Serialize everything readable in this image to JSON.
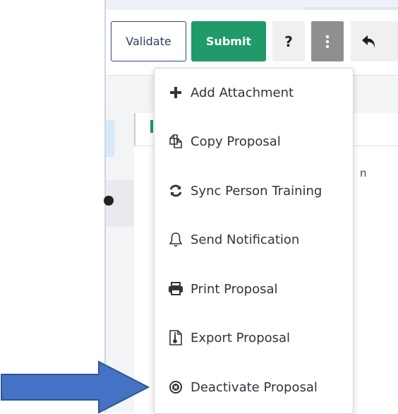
{
  "toolbar": {
    "validate_label": "Validate",
    "submit_label": "Submit",
    "help_label": "?",
    "more_icon": "vertical-ellipsis-icon",
    "undo_icon": "undo-arrow-icon"
  },
  "content": {
    "stray_text": "n"
  },
  "menu": {
    "items": [
      {
        "label": "Add Attachment",
        "icon": "plus-icon"
      },
      {
        "label": "Copy Proposal",
        "icon": "copy-icon"
      },
      {
        "label": "Sync Person Training",
        "icon": "sync-icon"
      },
      {
        "label": "Send Notification",
        "icon": "bell-icon"
      },
      {
        "label": "Print Proposal",
        "icon": "printer-icon"
      },
      {
        "label": "Export Proposal",
        "icon": "export-file-icon"
      },
      {
        "label": "Deactivate Proposal",
        "icon": "deactivate-circle-x-icon"
      }
    ]
  },
  "annotation": {
    "arrow_color": "#4472c4",
    "arrow_icon": "pointer-arrow-icon"
  },
  "colors": {
    "submit": "#1f9a68",
    "more_button": "#8f8f8f",
    "validate_border": "#2b4a7a"
  }
}
